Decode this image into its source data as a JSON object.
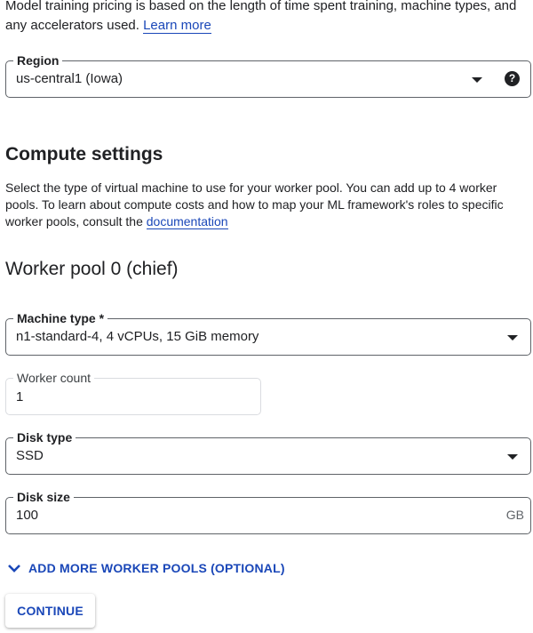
{
  "intro": {
    "text": "Model training pricing is based on the length of time spent training, machine types, and any accelerators used.",
    "link_label": "Learn more"
  },
  "region": {
    "label": "Region",
    "value": "us-central1 (Iowa)",
    "help_glyph": "?",
    "icons": [
      "dropdown-arrow-icon",
      "help-icon"
    ]
  },
  "compute": {
    "title": "Compute settings",
    "description": "Select the type of virtual machine to use for your worker pool. You can add up to 4 worker pools. To learn about compute costs and how to map your ML framework's roles to specific worker pools, consult the",
    "doc_link": "documentation"
  },
  "pool": {
    "title": "Worker pool 0 (chief)",
    "machine_type": {
      "label": "Machine type *",
      "value": "n1-standard-4, 4 vCPUs, 15 GiB memory"
    },
    "worker_count": {
      "label": "Worker count",
      "value": "1"
    },
    "disk_type": {
      "label": "Disk type",
      "value": "SSD"
    },
    "disk_size": {
      "label": "Disk size",
      "value": "100",
      "suffix": "GB"
    }
  },
  "actions": {
    "add_more": "ADD MORE WORKER POOLS (OPTIONAL)",
    "continue": "CONTINUE"
  },
  "colors": {
    "accent": "#1a47b8",
    "text": "#202124",
    "outline": "#5f6368"
  }
}
